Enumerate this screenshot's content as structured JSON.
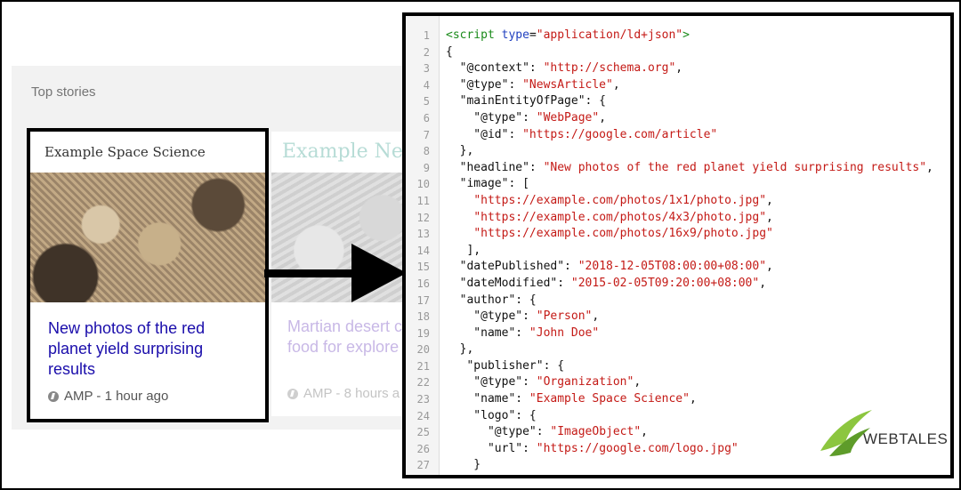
{
  "stories": {
    "heading": "Top stories",
    "cards": [
      {
        "source": "Example Space Science",
        "title": "New photos of the red planet yield surprising results",
        "meta": "AMP - 1 hour ago"
      },
      {
        "source": "Example New",
        "title": "Martian desert c food for explore",
        "meta": "AMP - 8 hours a"
      }
    ]
  },
  "code": {
    "lines": [
      {
        "n": "1",
        "t": "<script type=\"application/ld+json\">"
      },
      {
        "n": "2",
        "t": "{"
      },
      {
        "n": "3",
        "t": "  \"@context\": \"http://schema.org\","
      },
      {
        "n": "4",
        "t": "  \"@type\": \"NewsArticle\","
      },
      {
        "n": "5",
        "t": "  \"mainEntityOfPage\": {"
      },
      {
        "n": "6",
        "t": "    \"@type\": \"WebPage\","
      },
      {
        "n": "7",
        "t": "    \"@id\": \"https://google.com/article\""
      },
      {
        "n": "8",
        "t": "  },"
      },
      {
        "n": "9",
        "t": "  \"headline\": \"New photos of the red planet yield surprising results\","
      },
      {
        "n": "10",
        "t": "  \"image\": ["
      },
      {
        "n": "11",
        "t": "    \"https://example.com/photos/1x1/photo.jpg\","
      },
      {
        "n": "12",
        "t": "    \"https://example.com/photos/4x3/photo.jpg\","
      },
      {
        "n": "13",
        "t": "    \"https://example.com/photos/16x9/photo.jpg\""
      },
      {
        "n": "14",
        "t": "   ],"
      },
      {
        "n": "15",
        "t": "  \"datePublished\": \"2018-12-05T08:00:00+08:00\","
      },
      {
        "n": "16",
        "t": "  \"dateModified\": \"2015-02-05T09:20:00+08:00\","
      },
      {
        "n": "17",
        "t": "  \"author\": {"
      },
      {
        "n": "18",
        "t": "    \"@type\": \"Person\","
      },
      {
        "n": "19",
        "t": "    \"name\": \"John Doe\""
      },
      {
        "n": "20",
        "t": "  },"
      },
      {
        "n": "21",
        "t": "   \"publisher\": {"
      },
      {
        "n": "22",
        "t": "    \"@type\": \"Organization\","
      },
      {
        "n": "23",
        "t": "    \"name\": \"Example Space Science\","
      },
      {
        "n": "24",
        "t": "    \"logo\": {"
      },
      {
        "n": "25",
        "t": "      \"@type\": \"ImageObject\","
      },
      {
        "n": "26",
        "t": "      \"url\": \"https://google.com/logo.jpg\""
      },
      {
        "n": "27",
        "t": "    }"
      }
    ]
  },
  "logo": {
    "text": "WEBTALES"
  },
  "colors": {
    "link": "#1a0dab",
    "string": "#c41a16",
    "tag": "#1a8a1a",
    "attr": "#1f3fbf",
    "logo_green": "#8cc63f"
  }
}
